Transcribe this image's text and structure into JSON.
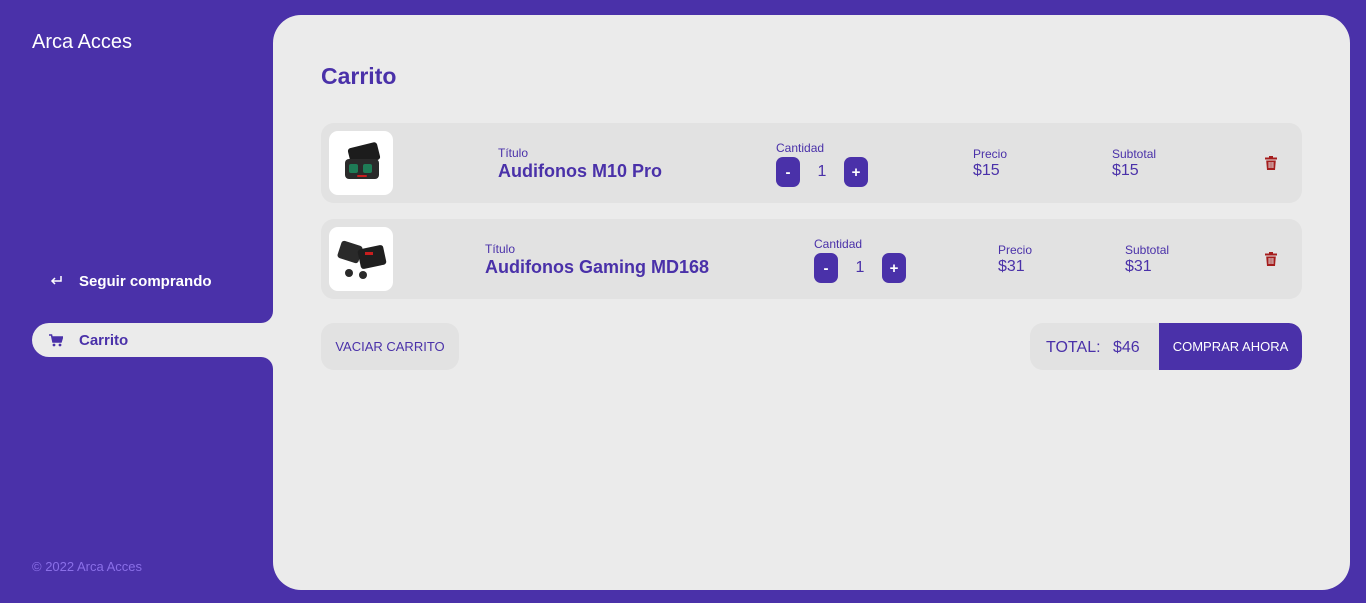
{
  "brand": "Arca Acces",
  "nav": {
    "seguir_label": "Seguir comprando",
    "carrito_label": "Carrito"
  },
  "footer": "© 2022 Arca Acces",
  "page_title": "Carrito",
  "labels": {
    "title": "Título",
    "quantity": "Cantidad",
    "price": "Precio",
    "subtotal": "Subtotal",
    "minus": "-",
    "plus": "+"
  },
  "items": [
    {
      "name": "Audifonos M10 Pro",
      "quantity": "1",
      "price": "$15",
      "subtotal": "$15"
    },
    {
      "name": "Audifonos Gaming MD168",
      "quantity": "1",
      "price": "$31",
      "subtotal": "$31"
    }
  ],
  "actions": {
    "empty_cart": "VACIAR CARRITO",
    "buy_now": "COMPRAR AHORA"
  },
  "total": {
    "label": "TOTAL:",
    "value": "$46"
  },
  "colors": {
    "accent": "#4a31a9",
    "panel": "#ebebeb",
    "row": "#e2e2e2",
    "delete": "#a51d1d"
  },
  "icons": {
    "seguir": "return-arrow-icon",
    "carrito": "cart-icon",
    "delete": "trash-icon"
  }
}
